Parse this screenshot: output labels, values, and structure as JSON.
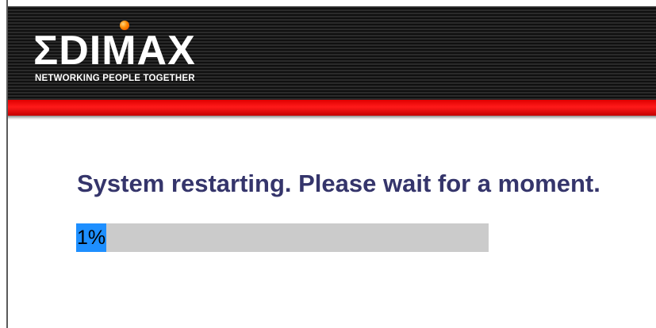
{
  "brand": {
    "logo_text": "ΣDIMAX",
    "tagline": "NETWORKING PEOPLE TOGETHER"
  },
  "status": {
    "message": "System restarting. Please wait for a moment."
  },
  "progress": {
    "percent": 1,
    "label": "1%"
  },
  "colors": {
    "header_background": "#121212",
    "header_stripe": "#2a2a2a",
    "accent_red": "#e00000",
    "message_text": "#35356b",
    "progress_fill": "#1e8fff",
    "progress_track": "#cbcbcb"
  }
}
